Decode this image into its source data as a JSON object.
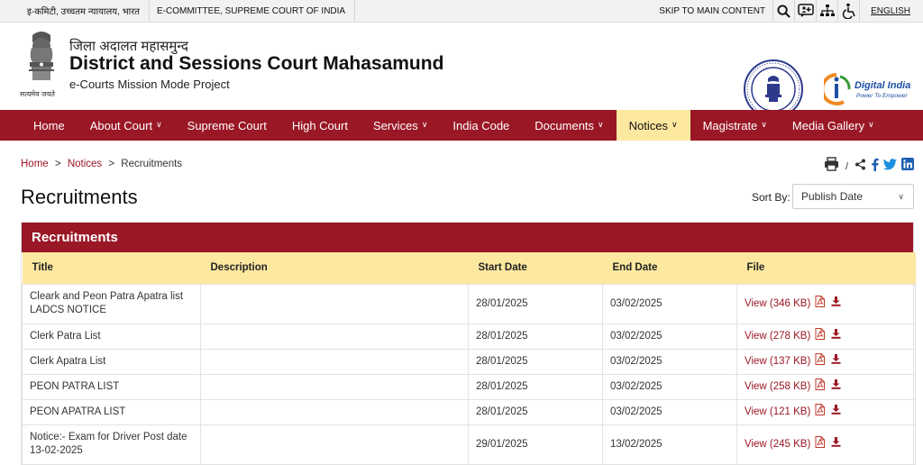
{
  "topbar": {
    "hindi_link": "इ-कमिटी, उच्चतम न्यायालय, भारत",
    "ecommittee_link": "E-COMMITTEE, SUPREME COURT OF INDIA",
    "skip_link": "SKIP TO MAIN CONTENT",
    "language": "ENGLISH"
  },
  "header": {
    "hindi_title": "जिला अदालत महासमुन्द",
    "title": "District and Sessions Court Mahasamund",
    "subtitle": "e-Courts Mission Mode Project",
    "motto": "सत्यमेव जयते",
    "digital_india_title": "Digital India",
    "digital_india_tagline": "Power To Empower"
  },
  "nav": {
    "items": [
      {
        "label": "Home",
        "dropdown": false
      },
      {
        "label": "About Court",
        "dropdown": true
      },
      {
        "label": "Supreme Court",
        "dropdown": false
      },
      {
        "label": "High Court",
        "dropdown": false
      },
      {
        "label": "Services",
        "dropdown": true
      },
      {
        "label": "India Code",
        "dropdown": false
      },
      {
        "label": "Documents",
        "dropdown": true
      },
      {
        "label": "Notices",
        "dropdown": true,
        "active": true
      },
      {
        "label": "Magistrate",
        "dropdown": true
      },
      {
        "label": "Media Gallery",
        "dropdown": true
      }
    ]
  },
  "breadcrumb": {
    "home": "Home",
    "notices": "Notices",
    "current": "Recruitments"
  },
  "page": {
    "title": "Recruitments",
    "sort_label": "Sort By:",
    "sort_value": "Publish Date"
  },
  "table": {
    "heading": "Recruitments",
    "columns": [
      "Title",
      "Description",
      "Start Date",
      "End Date",
      "File"
    ],
    "rows": [
      {
        "title": "Cleark and Peon Patra Apatra list LADCS NOTICE",
        "description": "",
        "start": "28/01/2025",
        "end": "03/02/2025",
        "file": "View (346 KB)"
      },
      {
        "title": "Clerk Patra List",
        "description": "",
        "start": "28/01/2025",
        "end": "03/02/2025",
        "file": "View (278 KB)"
      },
      {
        "title": "Clerk Apatra List",
        "description": "",
        "start": "28/01/2025",
        "end": "03/02/2025",
        "file": "View (137 KB)"
      },
      {
        "title": "PEON PATRA LIST",
        "description": "",
        "start": "28/01/2025",
        "end": "03/02/2025",
        "file": "View (258 KB)"
      },
      {
        "title": "PEON APATRA LIST",
        "description": "",
        "start": "28/01/2025",
        "end": "03/02/2025",
        "file": "View (121 KB)"
      },
      {
        "title": "Notice:- Exam for Driver Post date 13-02-2025",
        "description": "",
        "start": "29/01/2025",
        "end": "13/02/2025",
        "file": "View (245 KB)"
      }
    ]
  },
  "colors": {
    "brand_maroon": "#9a1725",
    "header_yellow": "#fde8a0",
    "active_nav": "#fde8a0"
  }
}
